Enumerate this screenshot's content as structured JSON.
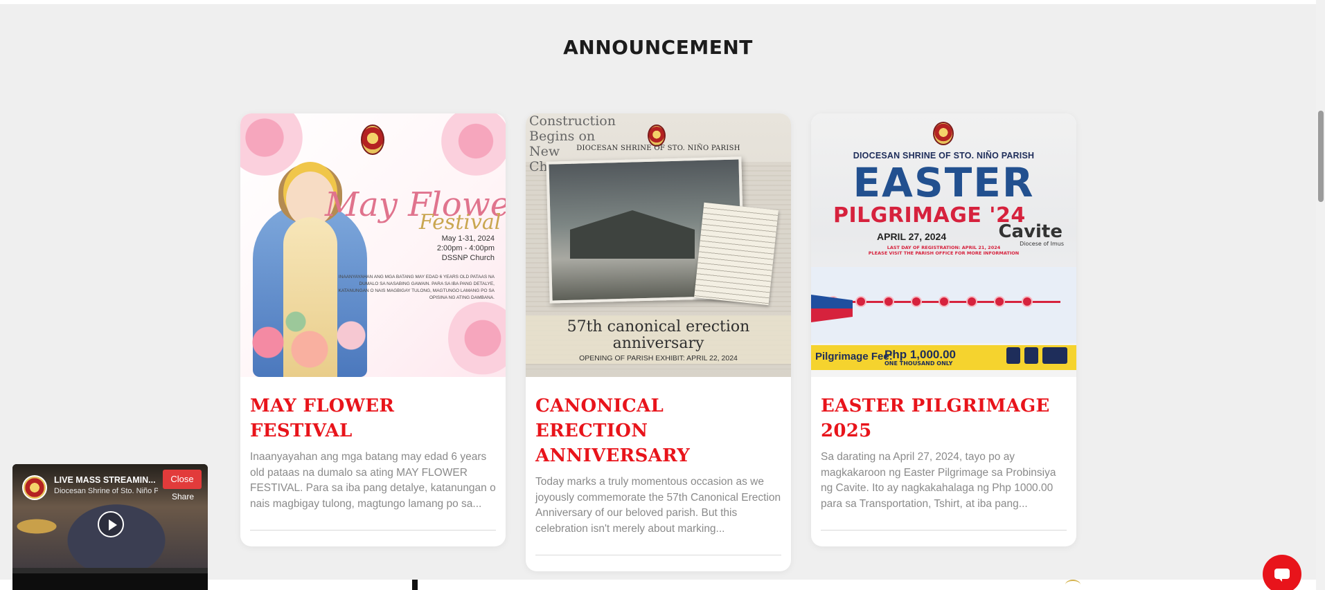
{
  "section": {
    "title": "ANNOUNCEMENT"
  },
  "cards": [
    {
      "title": "MAY FLOWER FESTIVAL",
      "excerpt": "Inaanyayahan ang mga batang may edad 6 years old pataas na dumalo sa ating MAY FLOWER FESTIVAL. Para sa iba pang detalye, katanungan o nais magbigay tulong, magtungo lamang po sa...",
      "poster": {
        "title": "May Flower",
        "subtitle": "Festival",
        "dates": "May 1-31, 2024",
        "time": "2:00pm - 4:00pm",
        "venue": "DSSNP Church",
        "note": "INAANYAYAHAN ANG MGA BATANG MAY EDAD 6 YEARS OLD PATAAS NA DUMALO SA NASABING GAWAIN. PARA SA IBA PANG DETALYE, KATANUNGAN O NAIS MAGBIGAY TULONG, MAGTUNGO LAMANG PO SA OPISINA NG ATING DAMBANA."
      }
    },
    {
      "title": "CANONICAL ERECTION ANNIVERSARY",
      "excerpt": "Today marks a truly momentous occasion as we joyously commemorate the 57th Canonical Erection Anniversary of our beloved parish. But this celebration isn't merely about marking...",
      "poster": {
        "headline": "Construction Begins on New Church",
        "parish": "DIOCESAN SHRINE OF STO. NIÑO PARISH",
        "line1": "57th canonical erection",
        "line2": "anniversary",
        "line3": "OPENING OF PARISH EXHIBIT: APRIL 22, 2024"
      }
    },
    {
      "title": "EASTER PILGRIMAGE 2025",
      "excerpt": "Sa darating na April 27, 2024, tayo po ay magkakaroon ng Easter Pilgrimage sa Probinsiya ng Cavite. Ito ay nagkakahalaga ng Php 1000.00 para sa Transportation, Tshirt, at iba pang...",
      "poster": {
        "parish": "DIOCESAN SHRINE OF STO. NIÑO PARISH",
        "easter": "EASTER",
        "pilgrimage": "PILGRIMAGE '24",
        "province": "Cavite",
        "diocese": "Diocese of Imus",
        "date": "APRIL 27, 2024",
        "reg1": "LAST DAY OF REGISTRATION: APRIL 21, 2024",
        "reg2": "PLEASE VISIT THE PARISH OFFICE FOR MORE INFORMATION",
        "fee_label": "Pilgrimage Fee:",
        "fee_value": "Php 1,000.00",
        "fee_words": "ONE THOUSAND ONLY"
      }
    }
  ],
  "live_widget": {
    "title": "LIVE MASS STREAMIN...",
    "subtitle": "Diocesan Shrine of Sto. Niño P",
    "close_label": "Close",
    "share_label": "Share"
  },
  "colors": {
    "accent": "#e8141b",
    "section_bg": "#efefef",
    "excerpt_text": "#8a8a8a"
  },
  "icons": {
    "chat": "chat-bubble-icon",
    "play": "play-icon"
  }
}
